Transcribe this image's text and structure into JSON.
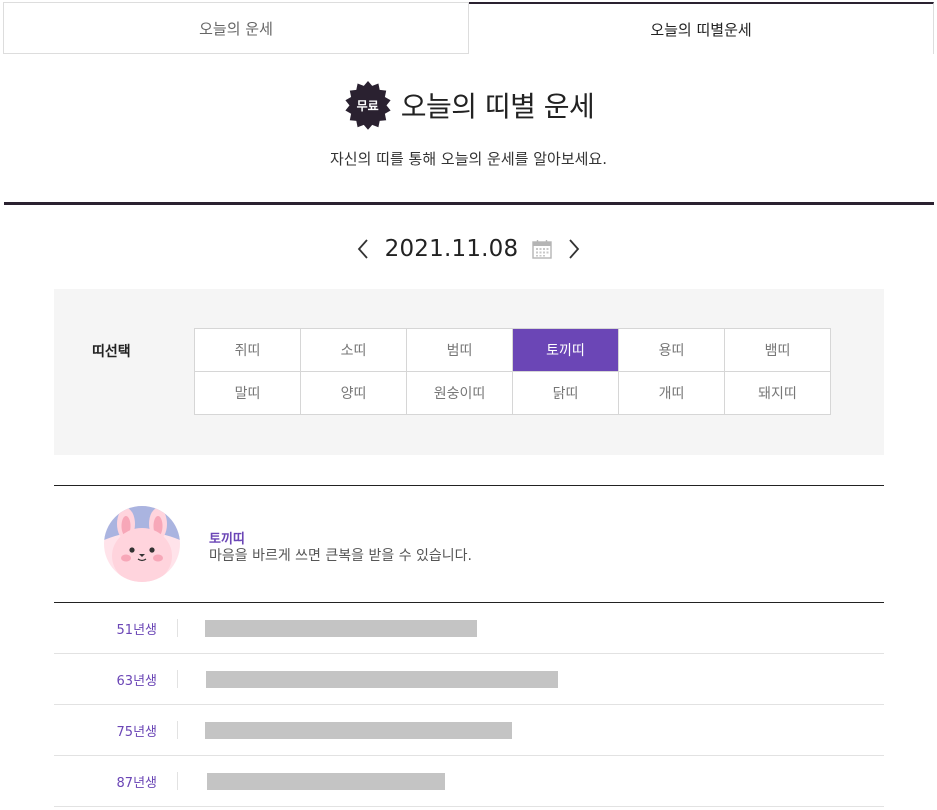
{
  "tabs": [
    {
      "label": "오늘의 운세",
      "active": false
    },
    {
      "label": "오늘의 띠별운세",
      "active": true
    }
  ],
  "hero": {
    "badge": "무료",
    "title": "오늘의 띠별 운세",
    "subtitle": "자신의 띠를 통해 오늘의 운세를 알아보세요."
  },
  "date_nav": {
    "prev_icon": "chevron-left-icon",
    "date": "2021.11.08",
    "calendar_icon": "calendar-icon",
    "next_icon": "chevron-right-icon"
  },
  "selector": {
    "label": "띠선택",
    "selected": "토끼띠",
    "options": [
      "쥐띠",
      "소띠",
      "범띠",
      "토끼띠",
      "용띠",
      "뱀띠",
      "말띠",
      "양띠",
      "원숭이띠",
      "닭띠",
      "개띠",
      "돼지띠"
    ]
  },
  "result": {
    "name": "토끼띠",
    "description": "마음을 바르게 쓰면 큰복을 받을 수 있습니다.",
    "avatar_icon": "rabbit-avatar-icon"
  },
  "years": [
    {
      "label": "51년생"
    },
    {
      "label": "63년생"
    },
    {
      "label": "75년생"
    },
    {
      "label": "87년생"
    }
  ],
  "colors": {
    "accent": "#6b46b6",
    "dark": "#2a2130",
    "panel_bg": "#f5f5f5",
    "placeholder_bar": "#c4c4c4"
  }
}
